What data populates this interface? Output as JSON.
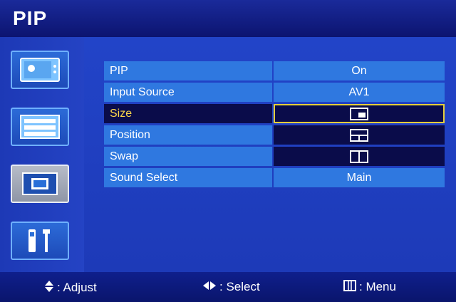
{
  "header": {
    "title": "PIP"
  },
  "sidebar": {
    "items": [
      {
        "icon": "picture-icon",
        "selected": false
      },
      {
        "icon": "setup-list-icon",
        "selected": false
      },
      {
        "icon": "pip-icon",
        "selected": true
      },
      {
        "icon": "tools-icon",
        "selected": false
      }
    ]
  },
  "menu": {
    "rows": [
      {
        "label": "PIP",
        "value": "On"
      },
      {
        "label": "Input Source",
        "value": "AV1"
      },
      {
        "label": "Size",
        "value_icon": "pip-size-small-icon",
        "selected": true
      },
      {
        "label": "Position",
        "value_icon": "pip-position-icon"
      },
      {
        "label": "Swap",
        "value_icon": "pip-swap-icon"
      },
      {
        "label": "Sound Select",
        "value": "Main"
      }
    ]
  },
  "footer": {
    "adjust": ": Adjust",
    "select": ": Select",
    "menu": ": Menu"
  },
  "colors": {
    "title_bar": "#0c1470",
    "panel": "#2244c8",
    "row": "#2f78e0",
    "row_selected_bg": "#0a0c4a",
    "row_selected_text": "#ffd84a",
    "highlight_border": "#e5cf3a"
  }
}
